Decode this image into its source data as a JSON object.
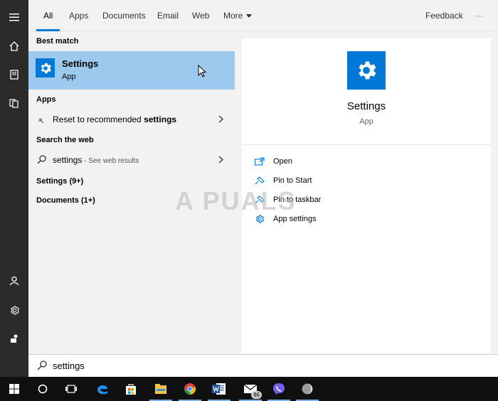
{
  "tabs": [
    {
      "label": "All"
    },
    {
      "label": "Apps"
    },
    {
      "label": "Documents"
    },
    {
      "label": "Email"
    },
    {
      "label": "Web"
    },
    {
      "label": "More"
    }
  ],
  "header_right": {
    "feedback": "Feedback",
    "ellipsis": "···"
  },
  "results": {
    "best_match_header": "Best match",
    "best_match": {
      "title": "Settings",
      "subtitle": "App",
      "icon": "gear-icon"
    },
    "apps_header": "Apps",
    "apps_item": {
      "prefix": "Reset to recommended ",
      "bold": "settings"
    },
    "web_header": "Search the web",
    "web_item": {
      "query": "settings",
      "suffix": " - See web results"
    },
    "settings_group": "Settings (9+)",
    "documents_group": "Documents (1+)"
  },
  "preview": {
    "title": "Settings",
    "subtitle": "App",
    "actions": [
      {
        "label": "Open",
        "icon": "open-icon"
      },
      {
        "label": "Pin to Start",
        "icon": "pin-icon"
      },
      {
        "label": "Pin to taskbar",
        "icon": "pin-icon"
      },
      {
        "label": "App settings",
        "icon": "gear-icon"
      }
    ]
  },
  "watermark": "A PUALS",
  "search": {
    "value": "settings"
  },
  "taskbar": {
    "mail_badge": "86",
    "icons": [
      "windows-start-icon",
      "cortana-icon",
      "task-view-icon",
      "edge-icon",
      "store-icon",
      "file-explorer-icon",
      "chrome-icon",
      "word-icon",
      "mail-icon",
      "viber-icon",
      "app-icon"
    ]
  },
  "colors": {
    "accent": "#0078d7",
    "selected": "#9dc9ee",
    "rail": "#2b2b2b",
    "taskbar": "#101010"
  }
}
